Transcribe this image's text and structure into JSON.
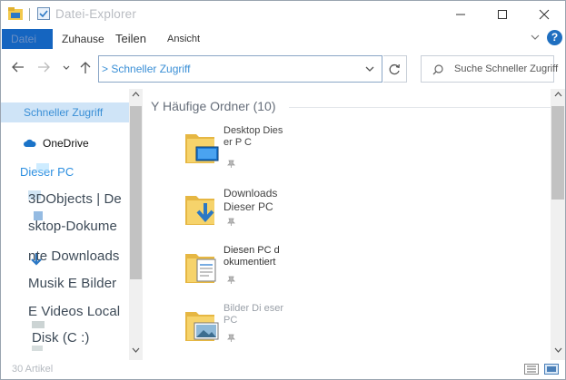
{
  "window": {
    "title": "Datei-Explorer"
  },
  "ribbon": {
    "file_tab": "Datei",
    "tabs": [
      "Zuhause",
      "Teilen",
      "Ansicht"
    ],
    "help_label": "?"
  },
  "address": {
    "path": "> Schneller Zugriff",
    "search_placeholder": "Suche Schneller Zugriff"
  },
  "nav": {
    "quick_access": "Schneller Zugriff",
    "onedrive": "OneDrive",
    "this_pc": "Dieser PC",
    "lines": [
      "3DObjects | De",
      "sktop-Dokume",
      "nte Downloads",
      "Musik E Bilder",
      "E Videos Local",
      "Disk (C :)"
    ]
  },
  "content": {
    "group_header": "Y Häufige Ordner (10)",
    "folders": [
      {
        "name": "Desktop Dieser P C",
        "icon": "desktop-folder-icon"
      },
      {
        "name": "Downloads Dieser PC",
        "icon": "downloads-folder-icon"
      },
      {
        "name": "Diesen PC d okumentiert",
        "icon": "documents-folder-icon"
      },
      {
        "name": "Bilder Di eser PC",
        "icon": "pictures-folder-icon"
      }
    ]
  },
  "status": {
    "item_count": "30 Artikel"
  },
  "colors": {
    "accent": "#1565c0",
    "link": "#3a8fd6",
    "selection": "#cfe4f7",
    "folder": "#f2c94c"
  }
}
